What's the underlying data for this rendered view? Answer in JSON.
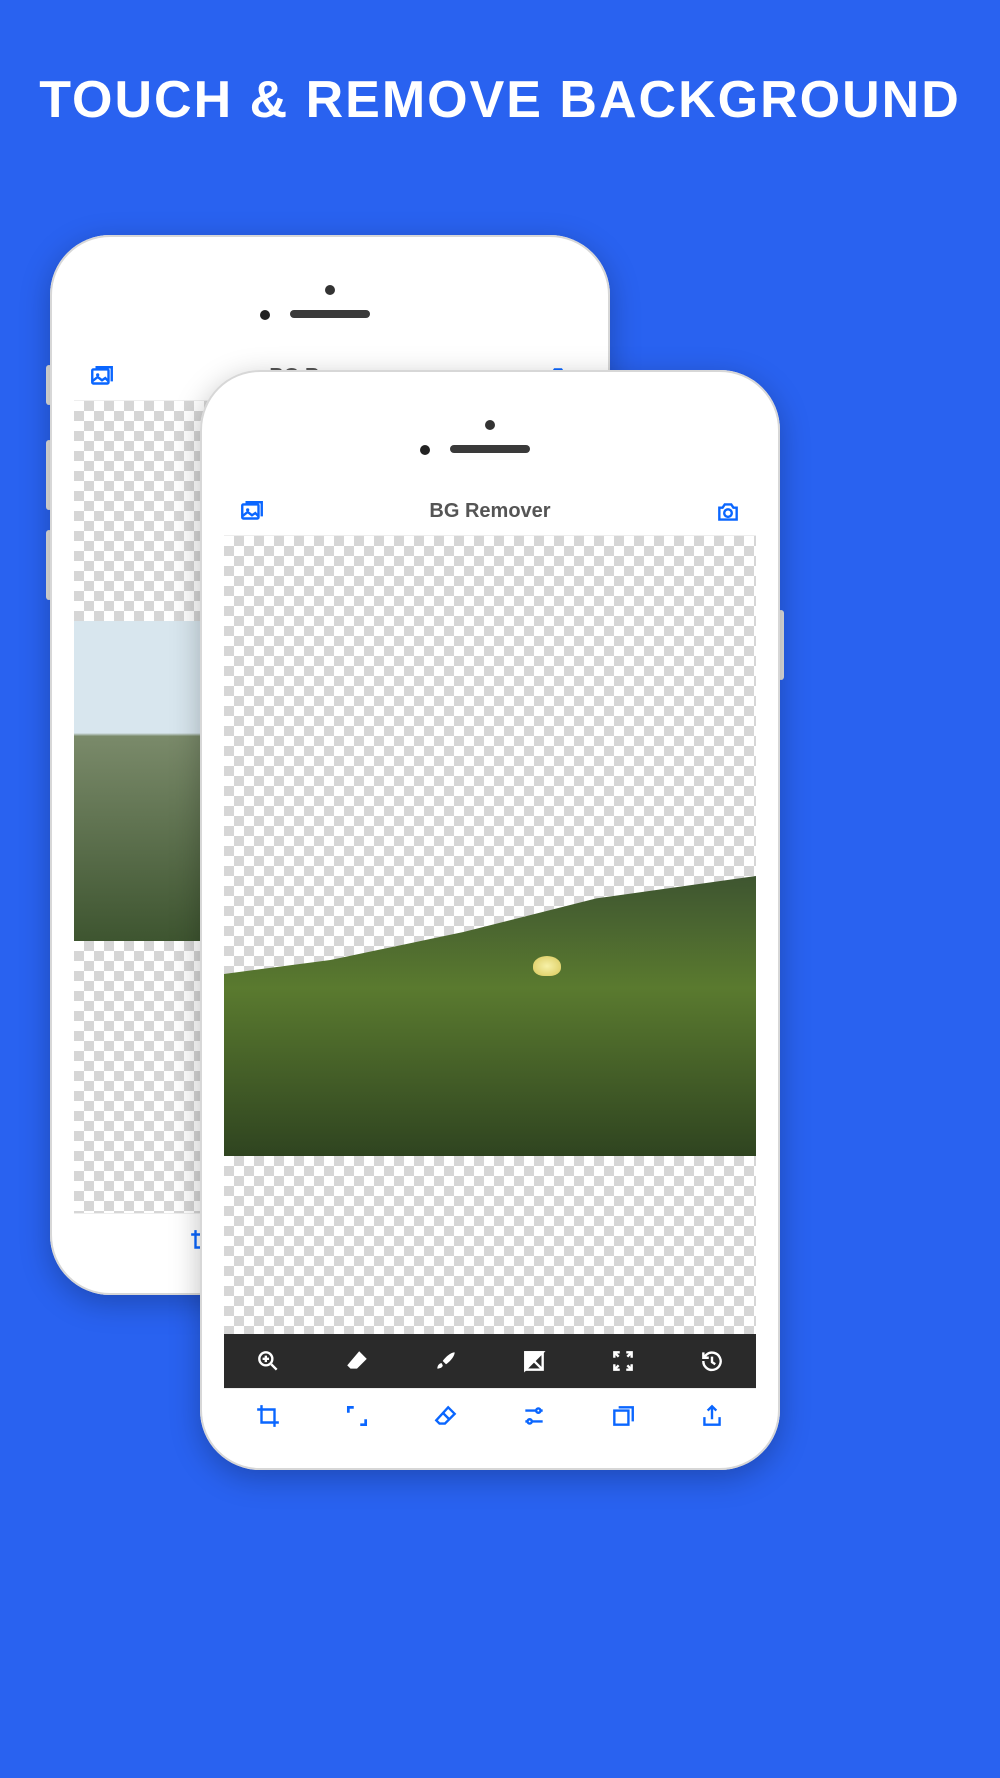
{
  "headline": "Touch & Remove Background",
  "app": {
    "title": "BG Remover"
  },
  "nav": {
    "gallery_icon": "gallery-icon",
    "camera_icon": "camera-icon"
  },
  "toolbar_dark": {
    "items": [
      "zoom-in-icon",
      "eraser-icon",
      "brush-icon",
      "invert-icon",
      "expand-icon",
      "history-icon"
    ]
  },
  "toolbar_light": {
    "items": [
      "crop-icon",
      "corners-icon",
      "eraser-tool-icon",
      "sliders-icon",
      "layers-icon",
      "share-icon"
    ]
  },
  "colors": {
    "accent": "#0a66ff",
    "page_bg": "#2962f0"
  }
}
